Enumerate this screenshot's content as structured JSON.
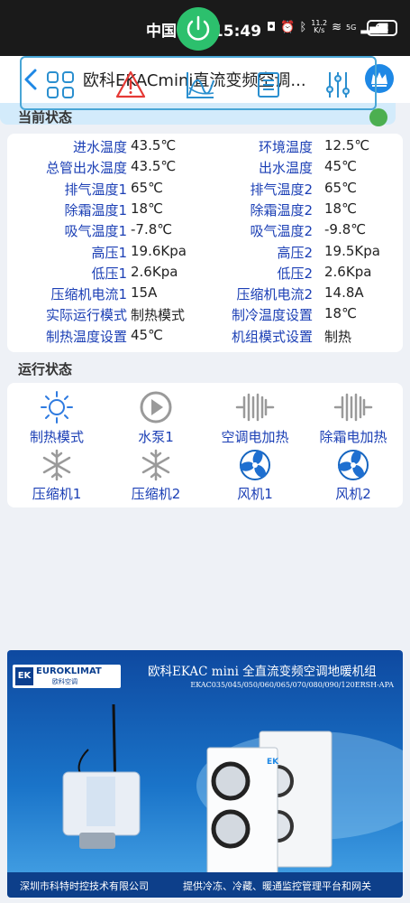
{
  "statusbar": {
    "carrier_time": "中国电信 15:49",
    "speed_value": "11.2",
    "speed_unit": "K/s",
    "network": "5G",
    "battery": "62"
  },
  "header": {
    "title": "欧科EKACmini直流变频空调...",
    "back_icon": "chevron-left-icon",
    "vip_icon": "crown-icon"
  },
  "current_status": {
    "label": "当前状态",
    "online_color": "#4caf50",
    "rows": [
      {
        "l1": "进水温度",
        "v1": "43.5℃",
        "l2": "环境温度",
        "v2": "12.5℃"
      },
      {
        "l1": "总管出水温度",
        "v1": "43.5℃",
        "l2": "出水温度",
        "v2": "45℃"
      },
      {
        "l1": "排气温度1",
        "v1": "65℃",
        "l2": "排气温度2",
        "v2": "65℃"
      },
      {
        "l1": "除霜温度1",
        "v1": "18℃",
        "l2": "除霜温度2",
        "v2": "18℃"
      },
      {
        "l1": "吸气温度1",
        "v1": "-7.8℃",
        "l2": "吸气温度2",
        "v2": "-9.8℃"
      },
      {
        "l1": "高压1",
        "v1": "19.6Kpa",
        "l2": "高压2",
        "v2": "19.5Kpa"
      },
      {
        "l1": "低压1",
        "v1": "2.6Kpa",
        "l2": "低压2",
        "v2": "2.6Kpa"
      },
      {
        "l1": "压缩机电流1",
        "v1": "15A",
        "l2": "压缩机电流2",
        "v2": "14.8A"
      },
      {
        "l1": "实际运行模式",
        "v1": "制热模式",
        "l2": "制冷温度设置",
        "v2": "18℃"
      },
      {
        "l1": "制热温度设置",
        "v1": "45℃",
        "l2": "机组模式设置",
        "v2": "制热"
      }
    ]
  },
  "run_status": {
    "label": "运行状态",
    "items": [
      {
        "label": "制热模式",
        "icon": "sun-icon"
      },
      {
        "label": "水泵1",
        "icon": "play-icon"
      },
      {
        "label": "空调电加热",
        "icon": "heater-coil-icon"
      },
      {
        "label": "除霜电加热",
        "icon": "heater-coil-icon"
      },
      {
        "label": "压缩机1",
        "icon": "snowflake-icon"
      },
      {
        "label": "压缩机2",
        "icon": "snowflake-icon"
      },
      {
        "label": "风机1",
        "icon": "fan-icon"
      },
      {
        "label": "风机2",
        "icon": "fan-icon"
      }
    ]
  },
  "controls": {
    "power_color": "#2cc06d",
    "tools": [
      "grid-icon",
      "alarm-icon",
      "chart-icon",
      "list-icon",
      "settings-icon"
    ]
  },
  "banner": {
    "logo_mark": "EK",
    "logo_name": "EUROKLIMAT",
    "logo_sub": "欧科空调",
    "title": "欧科EKAC mini 全直流变频空调地暖机组",
    "models": "EKAC035/045/050/060/065/070/080/090/120ERSH-APA",
    "footer_left": "深圳市科特时控技术有限公司",
    "footer_right": "提供冷冻、冷藏、暖通监控管理平台和网关"
  }
}
